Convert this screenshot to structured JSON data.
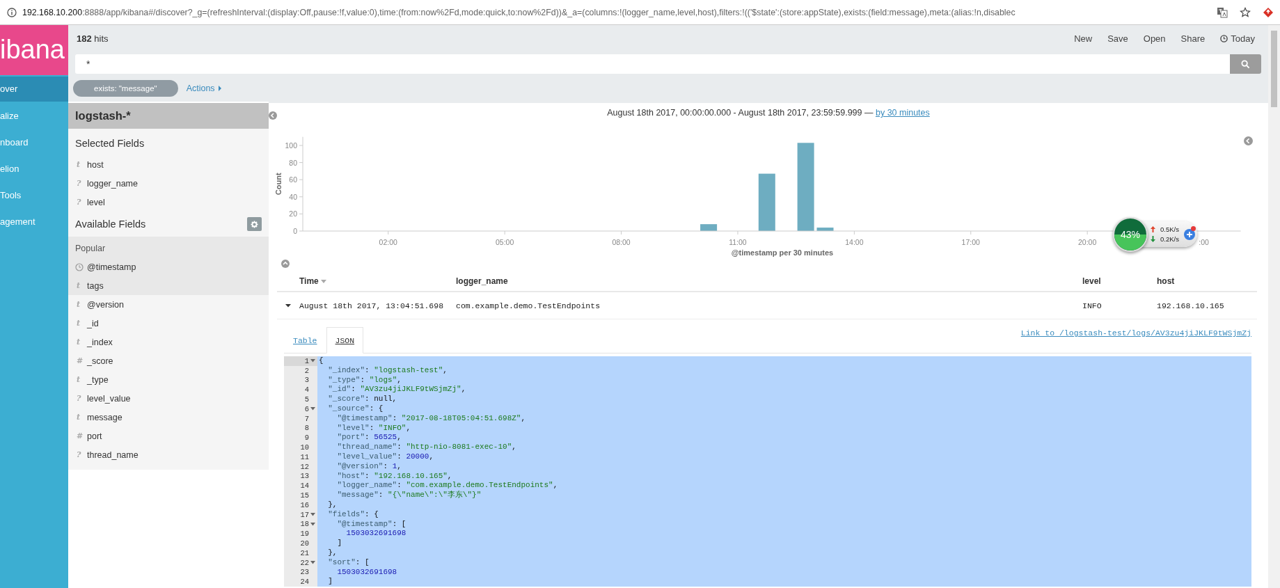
{
  "browser": {
    "url_host": "192.168.10.200",
    "url_rest": ":8888/app/kibana#/discover?_g=(refreshInterval:(display:Off,pause:!f,value:0),time:(from:now%2Fd,mode:quick,to:now%2Fd))&_a=(columns:!(logger_name,level,host),filters:!(('$state':(store:appState),exists:(field:message),meta:(alias:!n,disablec"
  },
  "nav": {
    "logo": "ibana",
    "items": [
      {
        "label": "over",
        "selected": true
      },
      {
        "label": "alize",
        "selected": false
      },
      {
        "label": "nboard",
        "selected": false
      },
      {
        "label": "elion",
        "selected": false
      },
      {
        "label": "Tools",
        "selected": false
      },
      {
        "label": "agement",
        "selected": false
      }
    ]
  },
  "topbar": {
    "hits": "**182** hits",
    "actions": [
      "New",
      "Save",
      "Open",
      "Share"
    ],
    "time_picker": "Today"
  },
  "search": {
    "value": "*"
  },
  "filters": [
    {
      "label": "exists: \"message\""
    }
  ],
  "filter_actions": "Actions",
  "sidebar": {
    "index_pattern": "logstash-*",
    "selected_title": "Selected Fields",
    "selected_fields": [
      {
        "glyph": "t",
        "kind": "type",
        "name": "host"
      },
      {
        "glyph": "?",
        "kind": "type",
        "name": "logger_name"
      },
      {
        "glyph": "?",
        "kind": "type",
        "name": "level"
      }
    ],
    "available_title": "Available Fields",
    "popular_label": "Popular",
    "available_fields": [
      {
        "kind": "date",
        "name": "@timestamp",
        "popular": true
      },
      {
        "glyph": "t",
        "kind": "type",
        "name": "tags",
        "popular": true
      },
      {
        "glyph": "t",
        "kind": "type",
        "name": "@version",
        "popular": false
      },
      {
        "glyph": "t",
        "kind": "type",
        "name": "_id",
        "popular": false
      },
      {
        "glyph": "t",
        "kind": "type",
        "name": "_index",
        "popular": false
      },
      {
        "glyph": "#",
        "kind": "type",
        "name": "_score",
        "popular": false
      },
      {
        "glyph": "t",
        "kind": "type",
        "name": "_type",
        "popular": false
      },
      {
        "glyph": "?",
        "kind": "type",
        "name": "level_value",
        "popular": false
      },
      {
        "glyph": "t",
        "kind": "type",
        "name": "message",
        "popular": false
      },
      {
        "glyph": "#",
        "kind": "type",
        "name": "port",
        "popular": false
      },
      {
        "glyph": "?",
        "kind": "type",
        "name": "thread_name",
        "popular": false
      }
    ]
  },
  "histogram": {
    "range": "August 18th 2017, 00:00:00.000 - August 18th 2017, 23:59:59.999 —",
    "interval_link": "by 30 minutes",
    "covered_tick_label": ":00",
    "chart_data": {
      "type": "bar",
      "xlabel": "@timestamp per 30 minutes",
      "ylabel": "Count",
      "x": [
        10.25,
        11.75,
        12.75,
        13.25
      ],
      "values": [
        8,
        67,
        103,
        4
      ],
      "xlim": [
        -0.2,
        23.95
      ],
      "ylim": [
        0,
        110
      ],
      "xticks": [
        {
          "value": 2,
          "label": "02:00"
        },
        {
          "value": 5,
          "label": "05:00"
        },
        {
          "value": 8,
          "label": "08:00"
        },
        {
          "value": 11,
          "label": "11:00"
        },
        {
          "value": 14,
          "label": "14:00"
        },
        {
          "value": 17,
          "label": "17:00"
        },
        {
          "value": 20,
          "label": "20:00"
        }
      ],
      "yticks": [
        0,
        20,
        40,
        60,
        80,
        100
      ]
    }
  },
  "table": {
    "columns": [
      {
        "label": "Time",
        "sorted": true
      },
      {
        "label": "logger_name",
        "sorted": false
      },
      {
        "label": "level",
        "sorted": false
      },
      {
        "label": "host",
        "sorted": false
      }
    ],
    "rows": [
      {
        "expanded": true,
        "cells": [
          "August 18th 2017, 13:04:51.698",
          "com.example.demo.TestEndpoints",
          "INFO",
          "192.168.10.165"
        ]
      }
    ]
  },
  "document": {
    "tabs": [
      {
        "label": "Table",
        "selected": false
      },
      {
        "label": "JSON",
        "selected": true
      }
    ],
    "link": "Link to /logstash-test/logs/AV3zu4jiJKLF9tWSjmZj",
    "lines": [
      {
        "n": "1",
        "fold": true,
        "active": true,
        "tokens": [
          {
            "kind": "punct",
            "text": "{"
          }
        ]
      },
      {
        "n": "2",
        "fold": false,
        "active": false,
        "tokens": [
          {
            "kind": "key",
            "text": "  \"_index\""
          },
          {
            "kind": "punct",
            "text": ": "
          },
          {
            "kind": "string",
            "text": "\"logstash-test\""
          },
          {
            "kind": "punct",
            "text": ","
          }
        ]
      },
      {
        "n": "3",
        "fold": false,
        "active": false,
        "tokens": [
          {
            "kind": "key",
            "text": "  \"_type\""
          },
          {
            "kind": "punct",
            "text": ": "
          },
          {
            "kind": "string",
            "text": "\"logs\""
          },
          {
            "kind": "punct",
            "text": ","
          }
        ]
      },
      {
        "n": "4",
        "fold": false,
        "active": false,
        "tokens": [
          {
            "kind": "key",
            "text": "  \"_id\""
          },
          {
            "kind": "punct",
            "text": ": "
          },
          {
            "kind": "string",
            "text": "\"AV3zu4jiJKLF9tWSjmZj\""
          },
          {
            "kind": "punct",
            "text": ","
          }
        ]
      },
      {
        "n": "5",
        "fold": false,
        "active": false,
        "tokens": [
          {
            "kind": "key",
            "text": "  \"_score\""
          },
          {
            "kind": "punct",
            "text": ": null,"
          }
        ]
      },
      {
        "n": "6",
        "fold": true,
        "active": false,
        "tokens": [
          {
            "kind": "key",
            "text": "  \"_source\""
          },
          {
            "kind": "punct",
            "text": ": {"
          }
        ]
      },
      {
        "n": "7",
        "fold": false,
        "active": false,
        "tokens": [
          {
            "kind": "key",
            "text": "    \"@timestamp\""
          },
          {
            "kind": "punct",
            "text": ": "
          },
          {
            "kind": "string",
            "text": "\"2017-08-18T05:04:51.698Z\""
          },
          {
            "kind": "punct",
            "text": ","
          }
        ]
      },
      {
        "n": "8",
        "fold": false,
        "active": false,
        "tokens": [
          {
            "kind": "key",
            "text": "    \"level\""
          },
          {
            "kind": "punct",
            "text": ": "
          },
          {
            "kind": "string",
            "text": "\"INFO\""
          },
          {
            "kind": "punct",
            "text": ","
          }
        ]
      },
      {
        "n": "9",
        "fold": false,
        "active": false,
        "tokens": [
          {
            "kind": "key",
            "text": "    \"port\""
          },
          {
            "kind": "punct",
            "text": ": "
          },
          {
            "kind": "number",
            "text": "56525"
          },
          {
            "kind": "punct",
            "text": ","
          }
        ]
      },
      {
        "n": "10",
        "fold": false,
        "active": false,
        "tokens": [
          {
            "kind": "key",
            "text": "    \"thread_name\""
          },
          {
            "kind": "punct",
            "text": ": "
          },
          {
            "kind": "string",
            "text": "\"http-nio-8081-exec-10\""
          },
          {
            "kind": "punct",
            "text": ","
          }
        ]
      },
      {
        "n": "11",
        "fold": false,
        "active": false,
        "tokens": [
          {
            "kind": "key",
            "text": "    \"level_value\""
          },
          {
            "kind": "punct",
            "text": ": "
          },
          {
            "kind": "number",
            "text": "20000"
          },
          {
            "kind": "punct",
            "text": ","
          }
        ]
      },
      {
        "n": "12",
        "fold": false,
        "active": false,
        "tokens": [
          {
            "kind": "key",
            "text": "    \"@version\""
          },
          {
            "kind": "punct",
            "text": ": "
          },
          {
            "kind": "number",
            "text": "1"
          },
          {
            "kind": "punct",
            "text": ","
          }
        ]
      },
      {
        "n": "13",
        "fold": false,
        "active": false,
        "tokens": [
          {
            "kind": "key",
            "text": "    \"host\""
          },
          {
            "kind": "punct",
            "text": ": "
          },
          {
            "kind": "string",
            "text": "\"192.168.10.165\""
          },
          {
            "kind": "punct",
            "text": ","
          }
        ]
      },
      {
        "n": "14",
        "fold": false,
        "active": false,
        "tokens": [
          {
            "kind": "key",
            "text": "    \"logger_name\""
          },
          {
            "kind": "punct",
            "text": ": "
          },
          {
            "kind": "string",
            "text": "\"com.example.demo.TestEndpoints\""
          },
          {
            "kind": "punct",
            "text": ","
          }
        ]
      },
      {
        "n": "15",
        "fold": false,
        "active": false,
        "tokens": [
          {
            "kind": "key",
            "text": "    \"message\""
          },
          {
            "kind": "punct",
            "text": ": "
          },
          {
            "kind": "string",
            "text": "\"{\\\"name\\\":\\\"李东\\\"}\""
          }
        ]
      },
      {
        "n": "16",
        "fold": false,
        "active": false,
        "tokens": [
          {
            "kind": "punct",
            "text": "  },"
          }
        ]
      },
      {
        "n": "17",
        "fold": true,
        "active": false,
        "tokens": [
          {
            "kind": "key",
            "text": "  \"fields\""
          },
          {
            "kind": "punct",
            "text": ": {"
          }
        ]
      },
      {
        "n": "18",
        "fold": true,
        "active": false,
        "tokens": [
          {
            "kind": "key",
            "text": "    \"@timestamp\""
          },
          {
            "kind": "punct",
            "text": ": ["
          }
        ]
      },
      {
        "n": "19",
        "fold": false,
        "active": false,
        "tokens": [
          {
            "kind": "number",
            "text": "      1503032691698"
          }
        ]
      },
      {
        "n": "20",
        "fold": false,
        "active": false,
        "tokens": [
          {
            "kind": "punct",
            "text": "    ]"
          }
        ]
      },
      {
        "n": "21",
        "fold": false,
        "active": false,
        "tokens": [
          {
            "kind": "punct",
            "text": "  },"
          }
        ]
      },
      {
        "n": "22",
        "fold": true,
        "active": false,
        "tokens": [
          {
            "kind": "key",
            "text": "  \"sort\""
          },
          {
            "kind": "punct",
            "text": ": ["
          }
        ]
      },
      {
        "n": "23",
        "fold": false,
        "active": false,
        "tokens": [
          {
            "kind": "number",
            "text": "    1503032691698"
          }
        ]
      },
      {
        "n": "24",
        "fold": false,
        "active": false,
        "tokens": [
          {
            "kind": "punct",
            "text": "  ]"
          }
        ]
      }
    ]
  },
  "monitor": {
    "reading": "43%",
    "upload": "0.5K/s",
    "download": "0.2K/s"
  }
}
